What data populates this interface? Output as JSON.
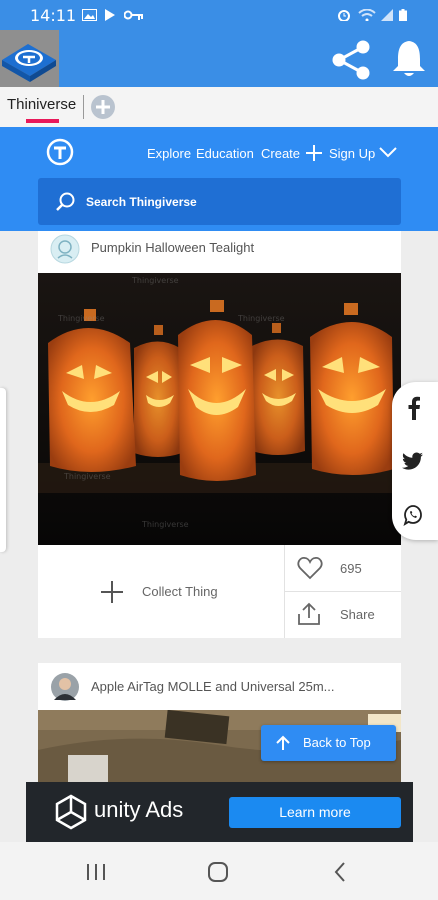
{
  "status_bar": {
    "time": "14:11"
  },
  "app": {
    "tab_label": "Thiniverse"
  },
  "site": {
    "nav": {
      "explore": "Explore",
      "education": "Education",
      "create": "Create",
      "signup": "Sign Up"
    },
    "search_placeholder": "Search Thingiverse"
  },
  "cards": [
    {
      "title": "Pumpkin Halloween Tealight",
      "likes": "695",
      "collect_label": "Collect Thing",
      "share_label": "Share",
      "watermark": "Thingiverse"
    },
    {
      "title": "Apple AirTag MOLLE and Universal 25m..."
    }
  ],
  "back_to_top": "Back to Top",
  "ad": {
    "brand": "unity Ads",
    "cta": "Learn more"
  },
  "colors": {
    "accent": "#2f8cf3",
    "search_bg": "#1f6fd4",
    "tab_indicator": "#e8195a"
  },
  "icons": [
    "share-icon",
    "bell-icon",
    "facebook-icon",
    "twitter-icon",
    "whatsapp-icon",
    "heart-icon",
    "upload-icon",
    "plus-icon",
    "search-icon"
  ]
}
